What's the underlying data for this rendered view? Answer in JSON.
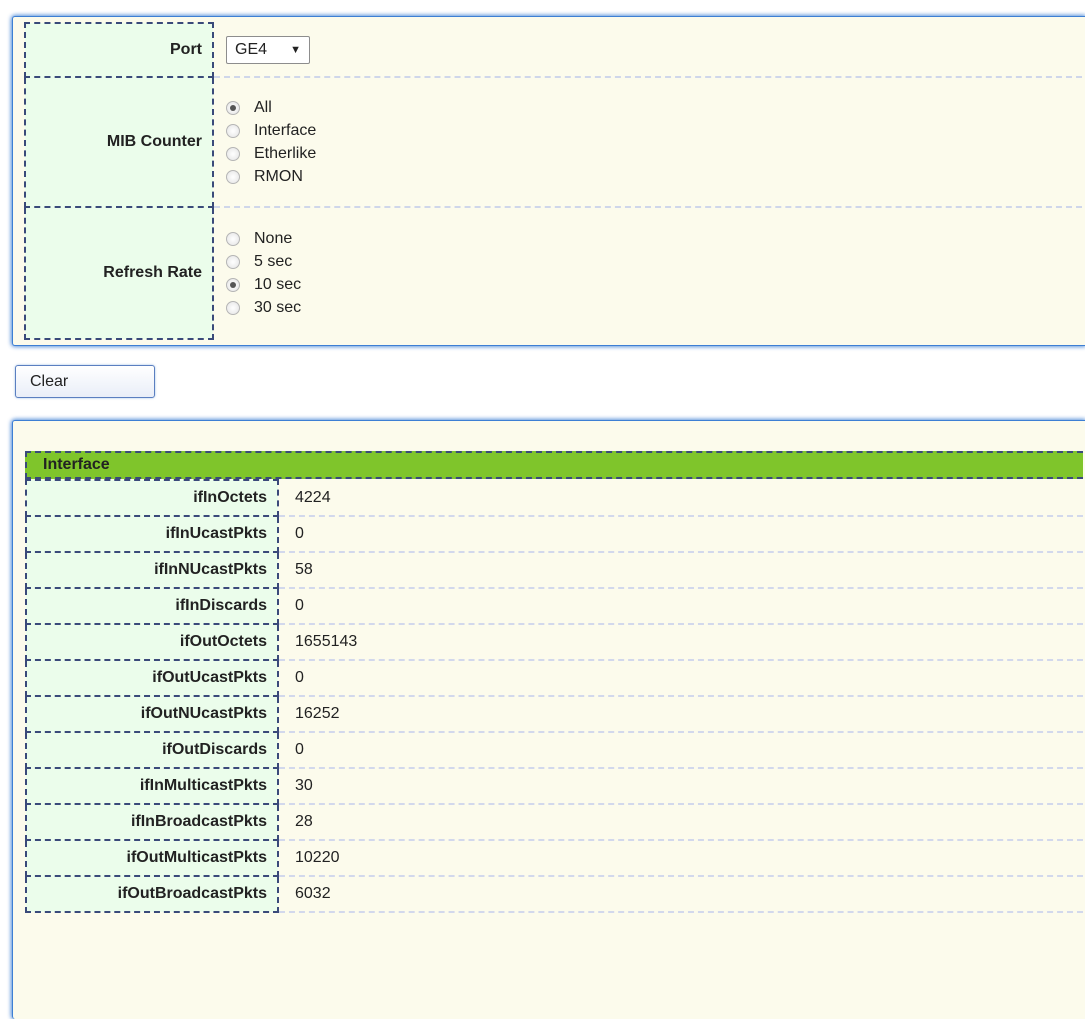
{
  "form": {
    "port": {
      "label": "Port",
      "selected": "GE4"
    },
    "mib_counter": {
      "label": "MIB Counter",
      "options": [
        {
          "label": "All",
          "checked": true
        },
        {
          "label": "Interface",
          "checked": false
        },
        {
          "label": "Etherlike",
          "checked": false
        },
        {
          "label": "RMON",
          "checked": false
        }
      ]
    },
    "refresh_rate": {
      "label": "Refresh Rate",
      "options": [
        {
          "label": "None",
          "checked": false
        },
        {
          "label": "5 sec",
          "checked": false
        },
        {
          "label": "10 sec",
          "checked": true
        },
        {
          "label": "30 sec",
          "checked": false
        }
      ]
    }
  },
  "actions": {
    "clear_label": "Clear"
  },
  "interface": {
    "title": "Interface",
    "rows": [
      {
        "name": "ifInOctets",
        "value": "4224"
      },
      {
        "name": "ifInUcastPkts",
        "value": "0"
      },
      {
        "name": "ifInNUcastPkts",
        "value": "58"
      },
      {
        "name": "ifInDiscards",
        "value": "0"
      },
      {
        "name": "ifOutOctets",
        "value": "1655143"
      },
      {
        "name": "ifOutUcastPkts",
        "value": "0"
      },
      {
        "name": "ifOutNUcastPkts",
        "value": "16252"
      },
      {
        "name": "ifOutDiscards",
        "value": "0"
      },
      {
        "name": "ifInMulticastPkts",
        "value": "30"
      },
      {
        "name": "ifInBroadcastPkts",
        "value": "28"
      },
      {
        "name": "ifOutMulticastPkts",
        "value": "10220"
      },
      {
        "name": "ifOutBroadcastPkts",
        "value": "6032"
      }
    ]
  },
  "colors": {
    "panel_bg": "#fcfbec",
    "label_bg": "#ebfdeb",
    "header_bg": "#7fc52b",
    "border_accent": "#3d7fd4"
  },
  "icons": {
    "dropdown": "caret-down-icon"
  }
}
